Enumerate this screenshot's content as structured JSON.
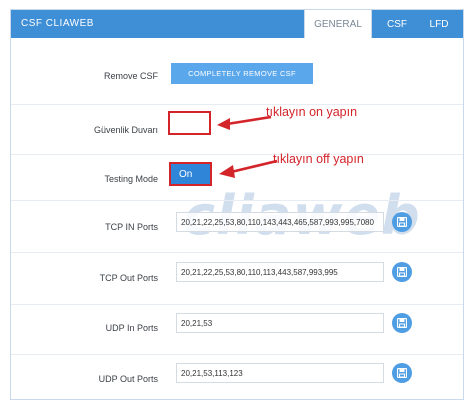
{
  "app_title": "CSF CLIAWEB",
  "tabs": {
    "general": "GENERAL",
    "csf": "CSF",
    "lfd": "LFD"
  },
  "remove_csf": {
    "label": "Remove CSF",
    "button": "COMPLETELY REMOVE CSF"
  },
  "firewall": {
    "label": "Güvenlik Duvarı",
    "value": ""
  },
  "testing_mode": {
    "label": "Testing Mode",
    "value": "On"
  },
  "annotations": {
    "firewall_hint": "tıklayın on yapın",
    "testing_hint": "tıklayın off yapın"
  },
  "watermark": "cliaweb",
  "ports": [
    {
      "label": "TCP IN Ports",
      "value": "20,21,22,25,53,80,110,143,443,465,587,993,995,7080"
    },
    {
      "label": "TCP Out Ports",
      "value": "20,21,22,25,53,80,110,113,443,587,993,995"
    },
    {
      "label": "UDP In Ports",
      "value": "20,21,53"
    },
    {
      "label": "UDP Out Ports",
      "value": "20,21,53,113,123"
    }
  ],
  "colors": {
    "header": "#3f8fd7",
    "accent_button": "#5ba7ec",
    "annotation_red": "#d3242a",
    "save_button": "#4f9de3"
  },
  "icons": {
    "save": "floppy-disk-icon",
    "arrow": "red-arrow-icon"
  }
}
